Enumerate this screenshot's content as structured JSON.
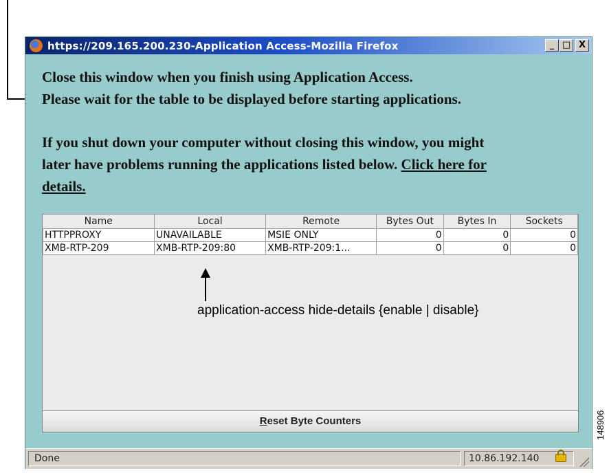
{
  "window": {
    "title": "https://209.165.200.230-Application Access-Mozilla Firefox",
    "controls": {
      "minimize": "_",
      "maximize": "□",
      "close": "X"
    }
  },
  "message": {
    "line1": "Close this window when you finish using Application Access.",
    "line2": "Please wait for the table to be displayed before starting applications.",
    "line3": "If you shut down your computer without closing this window, you might",
    "line4_text": "later have problems running the applications listed below.",
    "link_part1": "Click here for",
    "link_part2": "details."
  },
  "table": {
    "columns": [
      "Name",
      "Local",
      "Remote",
      "Bytes Out",
      "Bytes In",
      "Sockets"
    ],
    "rows": [
      [
        "HTTPPROXY",
        "UNAVAILABLE",
        "MSIE ONLY",
        "0",
        "0",
        "0"
      ],
      [
        "XMB-RTP-209",
        "XMB-RTP-209:80",
        "XMB-RTP-209:1...",
        "0",
        "0",
        "0"
      ]
    ]
  },
  "annotation": "application-access hide-details {enable | disable}",
  "reset_button": {
    "accel": "R",
    "rest": "eset Byte Counters"
  },
  "status": {
    "left": "Done",
    "ip": "10.86.192.140"
  },
  "figure_id": "148906",
  "icons": [
    "firefox-icon",
    "lock-icon",
    "resize-grip-icon"
  ]
}
